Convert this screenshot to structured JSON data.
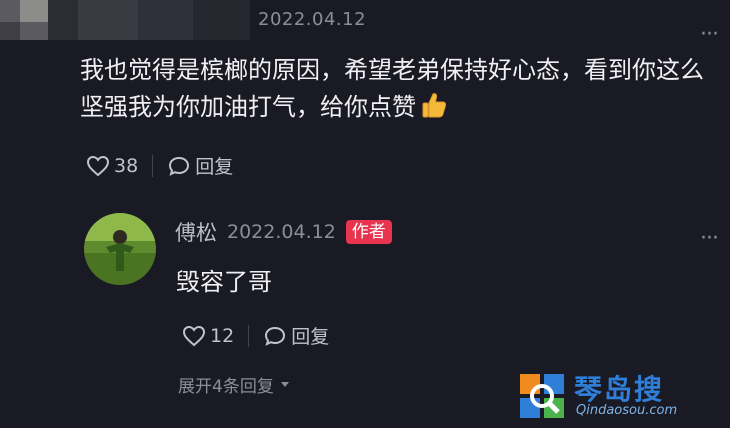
{
  "comment": {
    "date": "2022.04.12",
    "text": "我也觉得是槟榔的原因，希望老弟保持好心态，看到你这么坚强我为你加油打气，给你点赞",
    "emoji": "thumbs-up-icon",
    "likes": "38",
    "reply_label": "回复"
  },
  "reply": {
    "author": "傅松",
    "date": "2022.04.12",
    "badge": "作者",
    "text": "毁容了哥",
    "likes": "12",
    "reply_label": "回复"
  },
  "expand_label": "展开4条回复",
  "watermark": {
    "name_cn": "琴岛搜",
    "name_en": "Qindaosou.com"
  },
  "colors": {
    "background": "#1a1a24",
    "author_badge": "#e8344e",
    "watermark_blue": "#2f7ed8"
  }
}
